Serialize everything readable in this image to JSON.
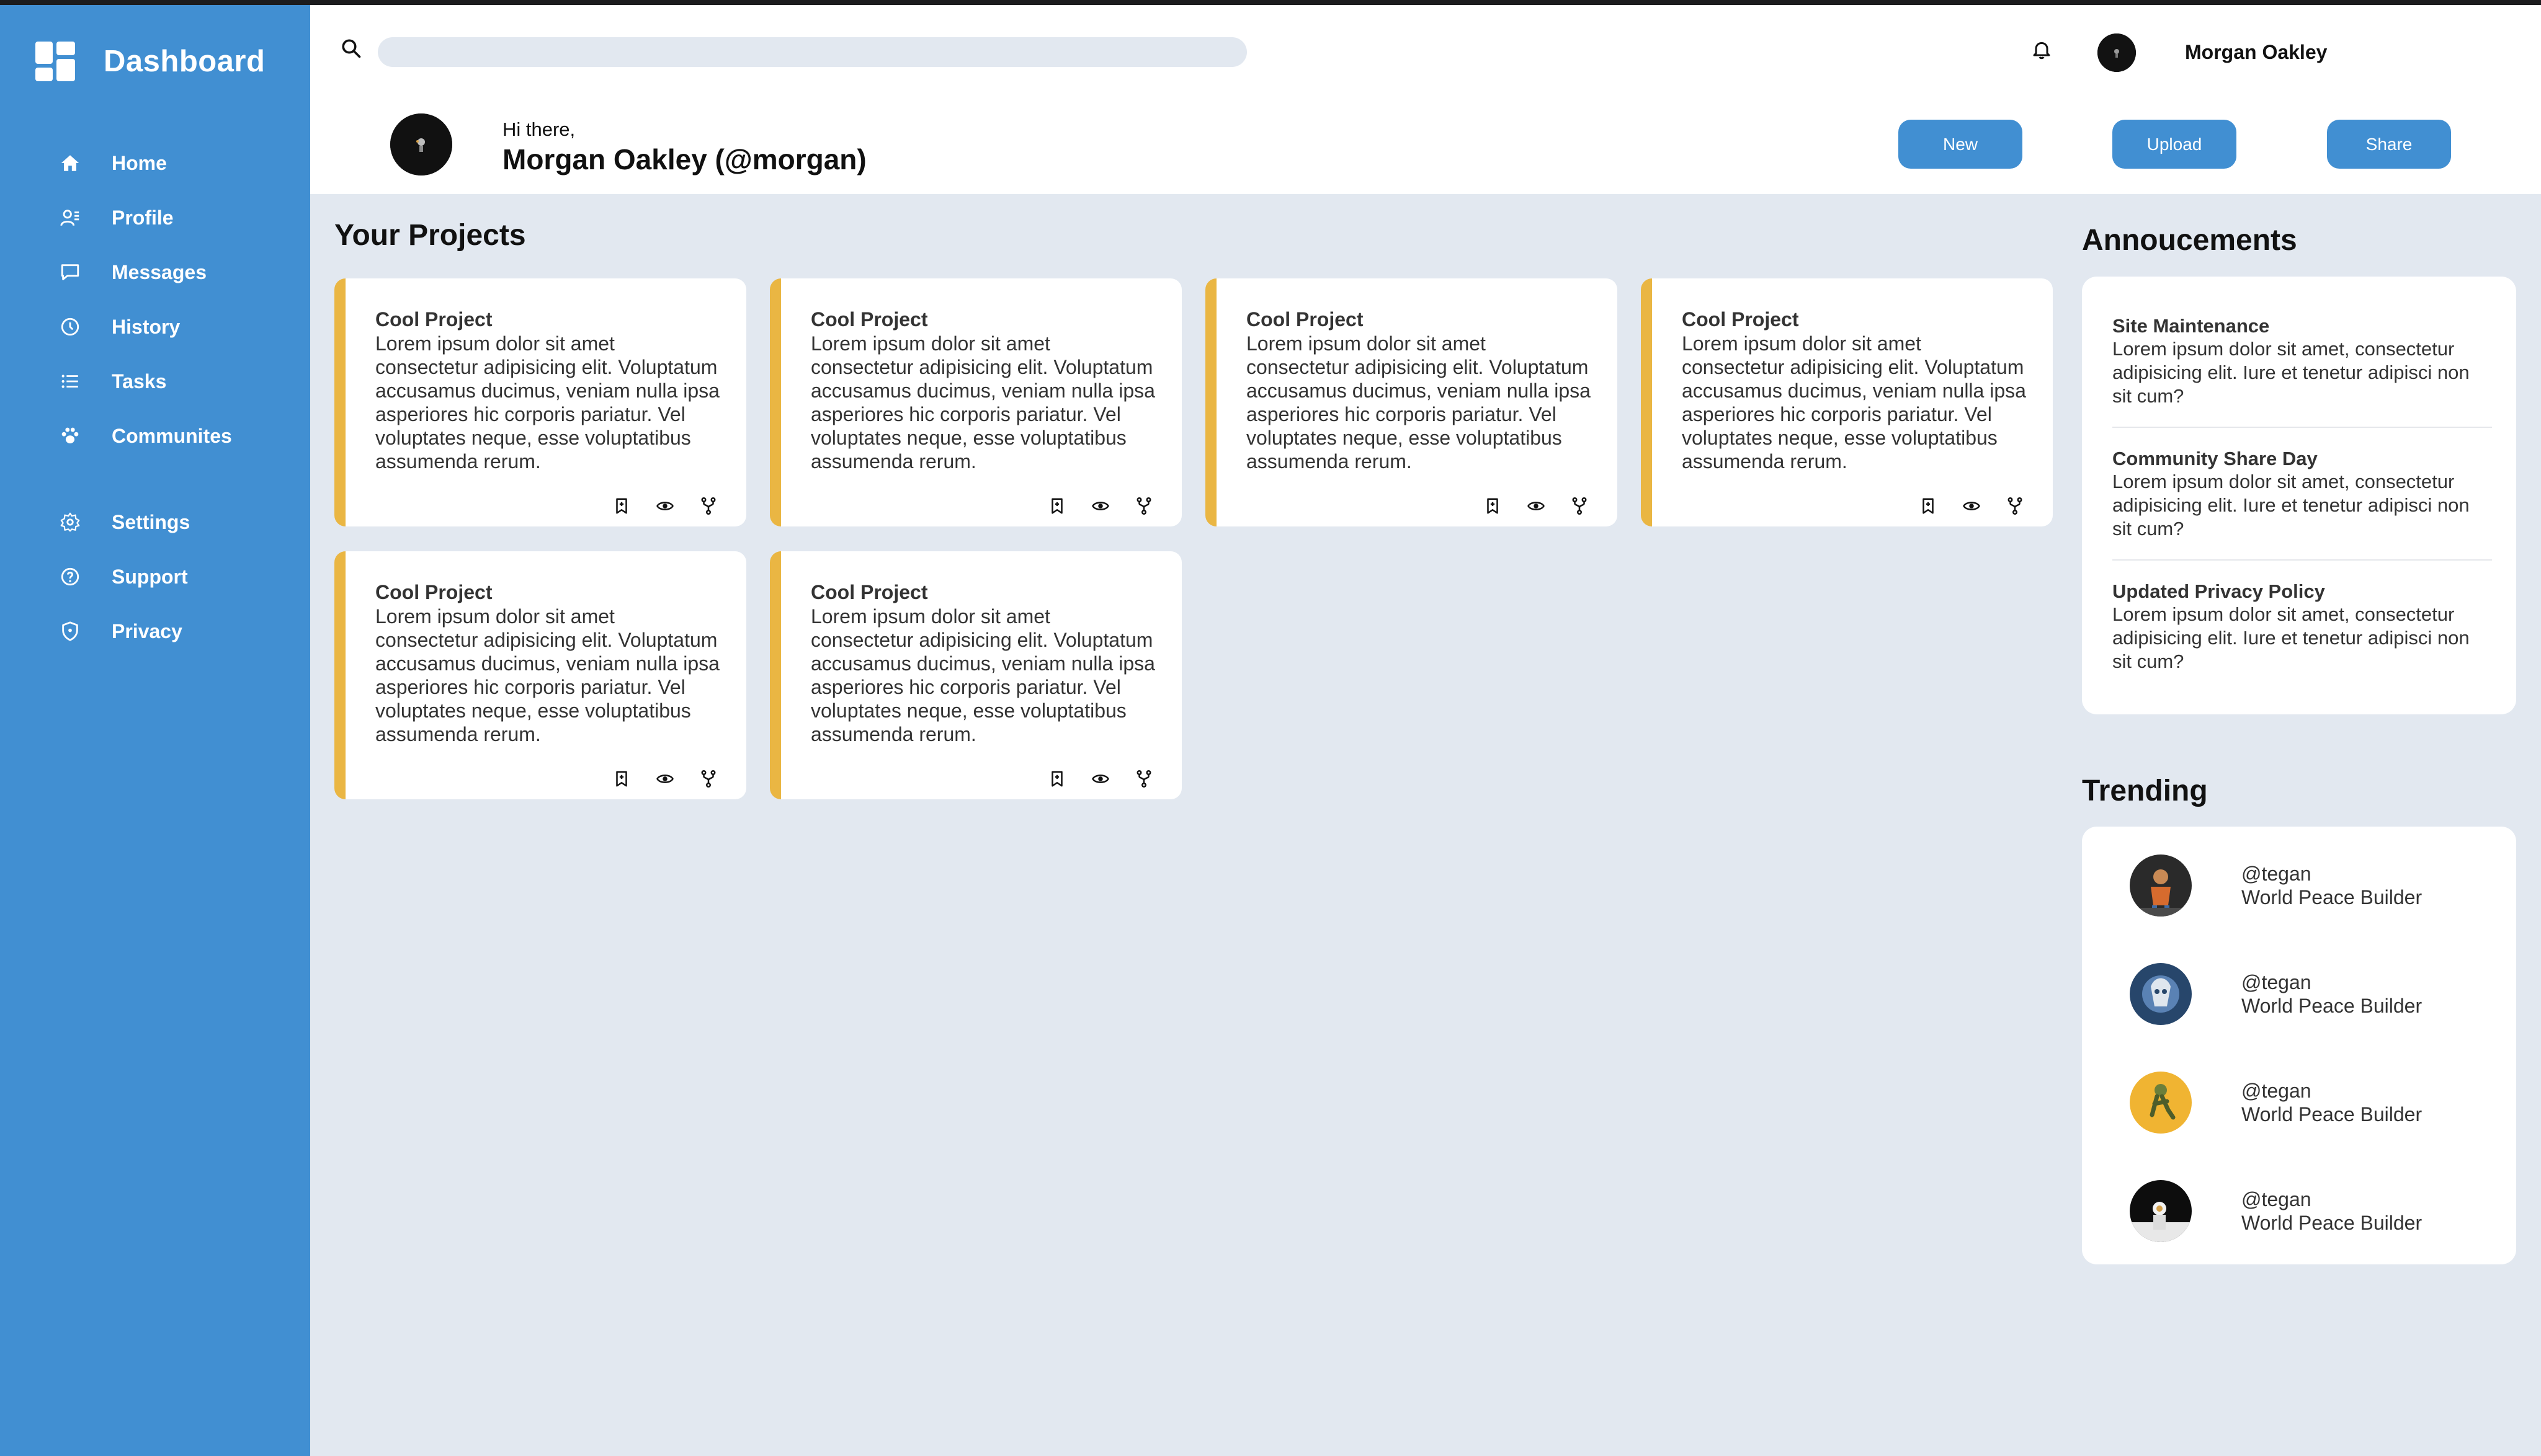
{
  "sidebar": {
    "title": "Dashboard",
    "items": [
      {
        "label": "Home",
        "icon": "home-icon"
      },
      {
        "label": "Profile",
        "icon": "profile-icon"
      },
      {
        "label": "Messages",
        "icon": "message-icon"
      },
      {
        "label": "History",
        "icon": "clock-icon"
      },
      {
        "label": "Tasks",
        "icon": "list-icon"
      },
      {
        "label": "Communites",
        "icon": "paw-icon"
      },
      {
        "label": "Settings",
        "icon": "gear-icon"
      },
      {
        "label": "Support",
        "icon": "help-icon"
      },
      {
        "label": "Privacy",
        "icon": "shield-icon"
      }
    ]
  },
  "topbar": {
    "search_placeholder": "",
    "user_name": "Morgan Oakley"
  },
  "greeting": {
    "hello": "Hi there,",
    "name": "Morgan Oakley (@morgan)"
  },
  "actions": {
    "new_label": "New",
    "upload_label": "Upload",
    "share_label": "Share"
  },
  "projects": {
    "heading": "Your Projects",
    "cards": [
      {
        "title": "Cool Project",
        "body": "Lorem ipsum dolor sit amet consectetur adipisicing elit. Voluptatum accusamus ducimus, veniam nulla ipsa asperiores hic corporis pariatur. Vel voluptates neque, esse voluptatibus assumenda rerum."
      },
      {
        "title": "Cool Project",
        "body": "Lorem ipsum dolor sit amet consectetur adipisicing elit. Voluptatum accusamus ducimus, veniam nulla ipsa asperiores hic corporis pariatur. Vel voluptates neque, esse voluptatibus assumenda rerum."
      },
      {
        "title": "Cool Project",
        "body": "Lorem ipsum dolor sit amet consectetur adipisicing elit. Voluptatum accusamus ducimus, veniam nulla ipsa asperiores hic corporis pariatur. Vel voluptates neque, esse voluptatibus assumenda rerum."
      },
      {
        "title": "Cool Project",
        "body": "Lorem ipsum dolor sit amet consectetur adipisicing elit. Voluptatum accusamus ducimus, veniam nulla ipsa asperiores hic corporis pariatur. Vel voluptates neque, esse voluptatibus assumenda rerum."
      },
      {
        "title": "Cool Project",
        "body": "Lorem ipsum dolor sit amet consectetur adipisicing elit. Voluptatum accusamus ducimus, veniam nulla ipsa asperiores hic corporis pariatur. Vel voluptates neque, esse voluptatibus assumenda rerum."
      },
      {
        "title": "Cool Project",
        "body": "Lorem ipsum dolor sit amet consectetur adipisicing elit. Voluptatum accusamus ducimus, veniam nulla ipsa asperiores hic corporis pariatur. Vel voluptates neque, esse voluptatibus assumenda rerum."
      }
    ],
    "card_action_icons": [
      "bookmark-icon",
      "eye-icon",
      "fork-icon"
    ]
  },
  "announcements": {
    "heading": "Annoucements",
    "items": [
      {
        "title": "Site Maintenance",
        "body": "Lorem ipsum dolor sit amet, consectetur adipisicing elit. Iure et tenetur adipisci non sit cum?"
      },
      {
        "title": "Community Share Day",
        "body": "Lorem ipsum dolor sit amet, consectetur adipisicing elit. Iure et tenetur adipisci non sit cum?"
      },
      {
        "title": "Updated Privacy Policy",
        "body": "Lorem ipsum dolor sit amet, consectetur adipisicing elit. Iure et tenetur adipisci non sit cum?"
      }
    ]
  },
  "trending": {
    "heading": "Trending",
    "items": [
      {
        "handle": "@tegan",
        "desc": "World Peace Builder"
      },
      {
        "handle": "@tegan",
        "desc": "World Peace Builder"
      },
      {
        "handle": "@tegan",
        "desc": "World Peace Builder"
      },
      {
        "handle": "@tegan",
        "desc": "World Peace Builder"
      }
    ]
  },
  "colors": {
    "sidebar": "#418fd2",
    "background": "#e2e8f0",
    "card_accent": "#eab643",
    "button": "#418fd2"
  }
}
